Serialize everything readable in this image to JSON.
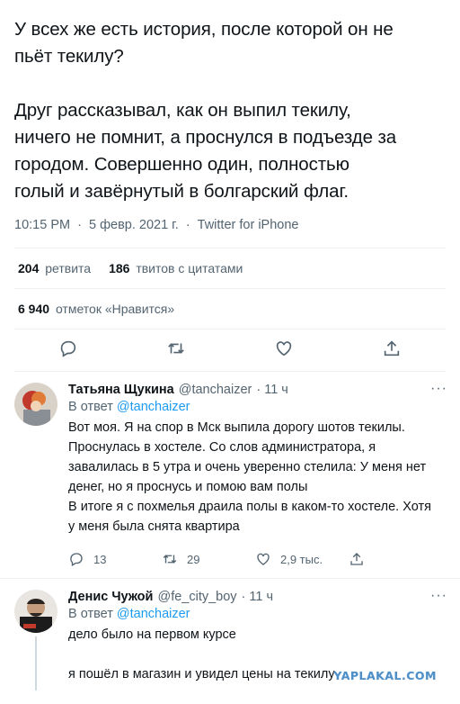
{
  "tweet": {
    "text_line1": "У всех же есть история, после которой он не",
    "text_line2": "пьёт текилу?",
    "text_line3": "Друг рассказывал, как он выпил текилу,",
    "text_line4": "ничего не помнит, а проснулся в подъезде за",
    "text_line5": "городом. Совершенно один, полностью",
    "text_line6": "голый и завёрнутый в болгарский флаг.",
    "time": "10:15 PM",
    "sep1": "·",
    "date": "5 февр. 2021 г.",
    "sep2": "·",
    "client": "Twitter for iPhone",
    "retweets_count": "204",
    "retweets_label": "ретвита",
    "quotes_count": "186",
    "quotes_label": "твитов с цитатами",
    "likes_count": "6 940",
    "likes_label": "отметок «Нравится»"
  },
  "replies": [
    {
      "name": "Татьяна Щукина",
      "handle": "@tanchaizer",
      "time": "· 11 ч",
      "reply_to_prefix": "В ответ",
      "reply_to_handle": "@tanchaizer",
      "lines": [
        "Вот моя. Я на спор в Мск выпила дорогу шотов текилы.",
        "Проснулась в хостеле. Со слов администратора, я",
        "завалилась в 5 утра и очень уверенно стелила: У меня нет",
        "денег, но я проснусь и помою вам полы",
        "В итоге я с похмелья драила полы в каком-то хостеле. Хотя",
        "у меня была снята квартира"
      ],
      "reply_count": "13",
      "retweet_count": "29",
      "like_count": "2,9 тыс."
    },
    {
      "name": "Денис Чужой",
      "handle": "@fe_city_boy",
      "time": "· 11 ч",
      "reply_to_prefix": "В ответ",
      "reply_to_handle": "@tanchaizer",
      "lines": [
        "дело было на первом курсе",
        "",
        "я пошёл в магазин и увидел цены на текилу"
      ]
    }
  ],
  "more_glyph": "···",
  "watermark": "YAPLAKAL.COM",
  "colors": {
    "accent": "#1d9bf0",
    "muted": "#536471",
    "text": "#0f1419"
  }
}
